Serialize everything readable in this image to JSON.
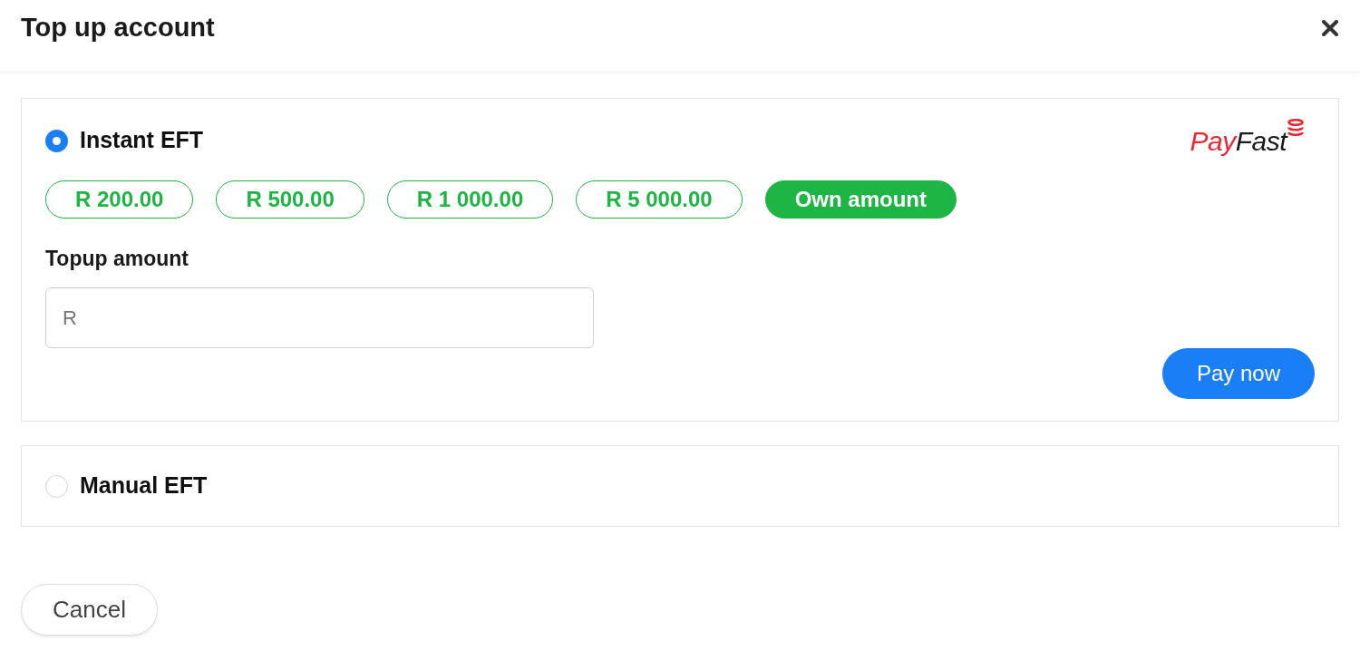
{
  "dialog": {
    "title": "Top up account"
  },
  "payment_methods": [
    {
      "label": "Instant EFT",
      "selected": true,
      "logo": {
        "parts": [
          {
            "text": "Pay",
            "color": "#ee2631"
          },
          {
            "text": "Fast",
            "color": "#1a1a1a"
          }
        ]
      },
      "amount_options": [
        {
          "label": "R 200.00",
          "selected": false
        },
        {
          "label": "R 500.00",
          "selected": false
        },
        {
          "label": "R 1 000.00",
          "selected": false
        },
        {
          "label": "R 5 000.00",
          "selected": false
        },
        {
          "label": "Own amount",
          "selected": true
        }
      ],
      "amount_field": {
        "label": "Topup amount",
        "placeholder": "R"
      },
      "submit_button": "Pay now"
    },
    {
      "label": "Manual EFT",
      "selected": false
    }
  ],
  "buttons": [
    "Cancel"
  ]
}
